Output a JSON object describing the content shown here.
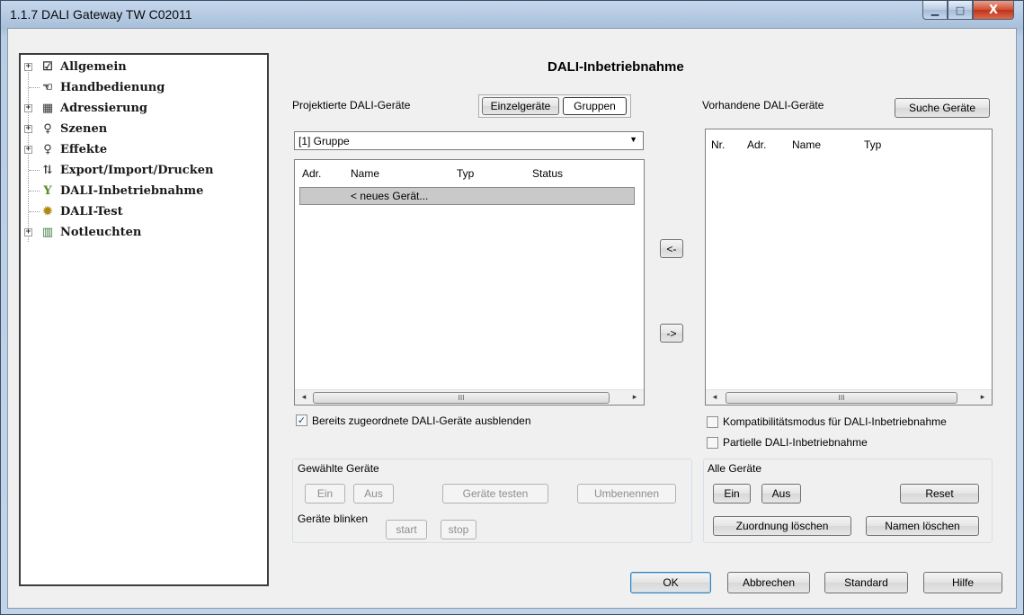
{
  "window": {
    "title": "1.1.7 DALI Gateway TW C02011",
    "minimize": "▁",
    "maximize": "□",
    "close": "X"
  },
  "tree": {
    "items": [
      {
        "label": "Allgemein",
        "icon": "checklist-icon",
        "glyph": "☑",
        "expandable": true
      },
      {
        "label": "Handbedienung",
        "icon": "hand-icon",
        "glyph": "☜",
        "expandable": false
      },
      {
        "label": "Adressierung",
        "icon": "grid-icon",
        "glyph": "▦",
        "expandable": true
      },
      {
        "label": "Szenen",
        "icon": "bulb-icon",
        "glyph": "♀",
        "expandable": true
      },
      {
        "label": "Effekte",
        "icon": "bulb-icon",
        "glyph": "♀",
        "expandable": true
      },
      {
        "label": "Export/Import/Drucken",
        "icon": "export-icon",
        "glyph": "⇅",
        "expandable": false
      },
      {
        "label": "DALI-Inbetriebnahme",
        "icon": "plug-icon",
        "glyph": "Y",
        "expandable": false
      },
      {
        "label": "DALI-Test",
        "icon": "gear-icon",
        "glyph": "✹",
        "expandable": false
      },
      {
        "label": "Notleuchten",
        "icon": "emergency-icon",
        "glyph": "▥",
        "expandable": true
      }
    ]
  },
  "main": {
    "title": "DALI-Inbetriebnahme",
    "projected": {
      "label": "Projektierte DALI-Geräte",
      "tab_single": "Einzelgeräte",
      "tab_groups": "Gruppen",
      "combo_value": "[1] Gruppe",
      "columns": [
        "Adr.",
        "Name",
        "Typ",
        "Status"
      ],
      "new_device": "< neues Gerät...",
      "hide_assigned": "Bereits zugeordnete DALI-Geräte ausblenden",
      "hide_assigned_checked": true
    },
    "transfer": {
      "left": "<-",
      "right": "->"
    },
    "available": {
      "label": "Vorhandene DALI-Geräte",
      "search": "Suche Geräte",
      "columns": [
        "Nr.",
        "Adr.",
        "Name",
        "Typ"
      ],
      "compat_mode": "Kompatibilitätsmodus für DALI-Inbetriebnahme",
      "partial": "Partielle DALI-Inbetriebnahme"
    },
    "selected_devices": {
      "label": "Gewählte Geräte",
      "on": "Ein",
      "off": "Aus",
      "test": "Geräte testen",
      "rename": "Umbenennen",
      "blink_label": "Geräte blinken",
      "start": "start",
      "stop": "stop"
    },
    "all_devices": {
      "label": "Alle Geräte",
      "on": "Ein",
      "off": "Aus",
      "reset": "Reset",
      "clear_assignment": "Zuordnung löschen",
      "clear_names": "Namen löschen"
    },
    "scroll_grip": "III",
    "arrow_left": "◂",
    "arrow_right": "▸"
  },
  "footer": {
    "ok": "OK",
    "cancel": "Abbrechen",
    "standard": "Standard",
    "help": "Hilfe"
  }
}
